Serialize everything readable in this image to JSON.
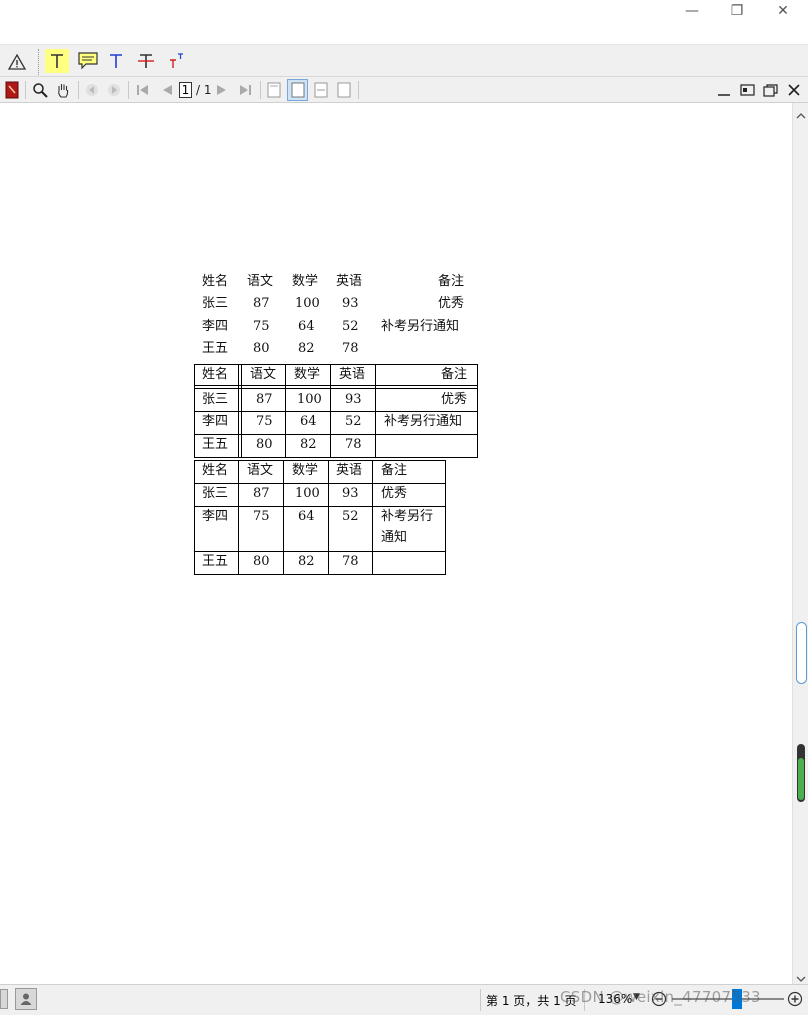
{
  "window": {
    "minimize_glyph": "—",
    "restore_glyph": "❐",
    "close_glyph": "✕"
  },
  "toolbar1": {
    "tools": [
      "warning-tool",
      "highlight-text-tool",
      "comment-tool",
      "text-tool",
      "strikeout-tool",
      "superscript-tool"
    ]
  },
  "toolbar2": {
    "page_input": "1",
    "page_total": "/ 1"
  },
  "tables": {
    "headers": [
      "姓名",
      "语文",
      "数学",
      "英语",
      "备注"
    ],
    "rows": [
      [
        "张三",
        "87",
        "100",
        "93",
        "优秀"
      ],
      [
        "李四",
        "75",
        "64",
        "52",
        "补考另行通知"
      ],
      [
        "王五",
        "80",
        "82",
        "78",
        ""
      ]
    ],
    "wrapped_note_line1": "补考另行",
    "wrapped_note_line2": "通知"
  },
  "status": {
    "page_text": "第 1 页，共 1 页",
    "zoom": "136%",
    "watermark": "CSDN @weixin_47707533"
  },
  "colors": {
    "accent_blue": "#0078d7",
    "highlight_yellow": "#ffff80",
    "scroll_green": "#4caf50"
  }
}
